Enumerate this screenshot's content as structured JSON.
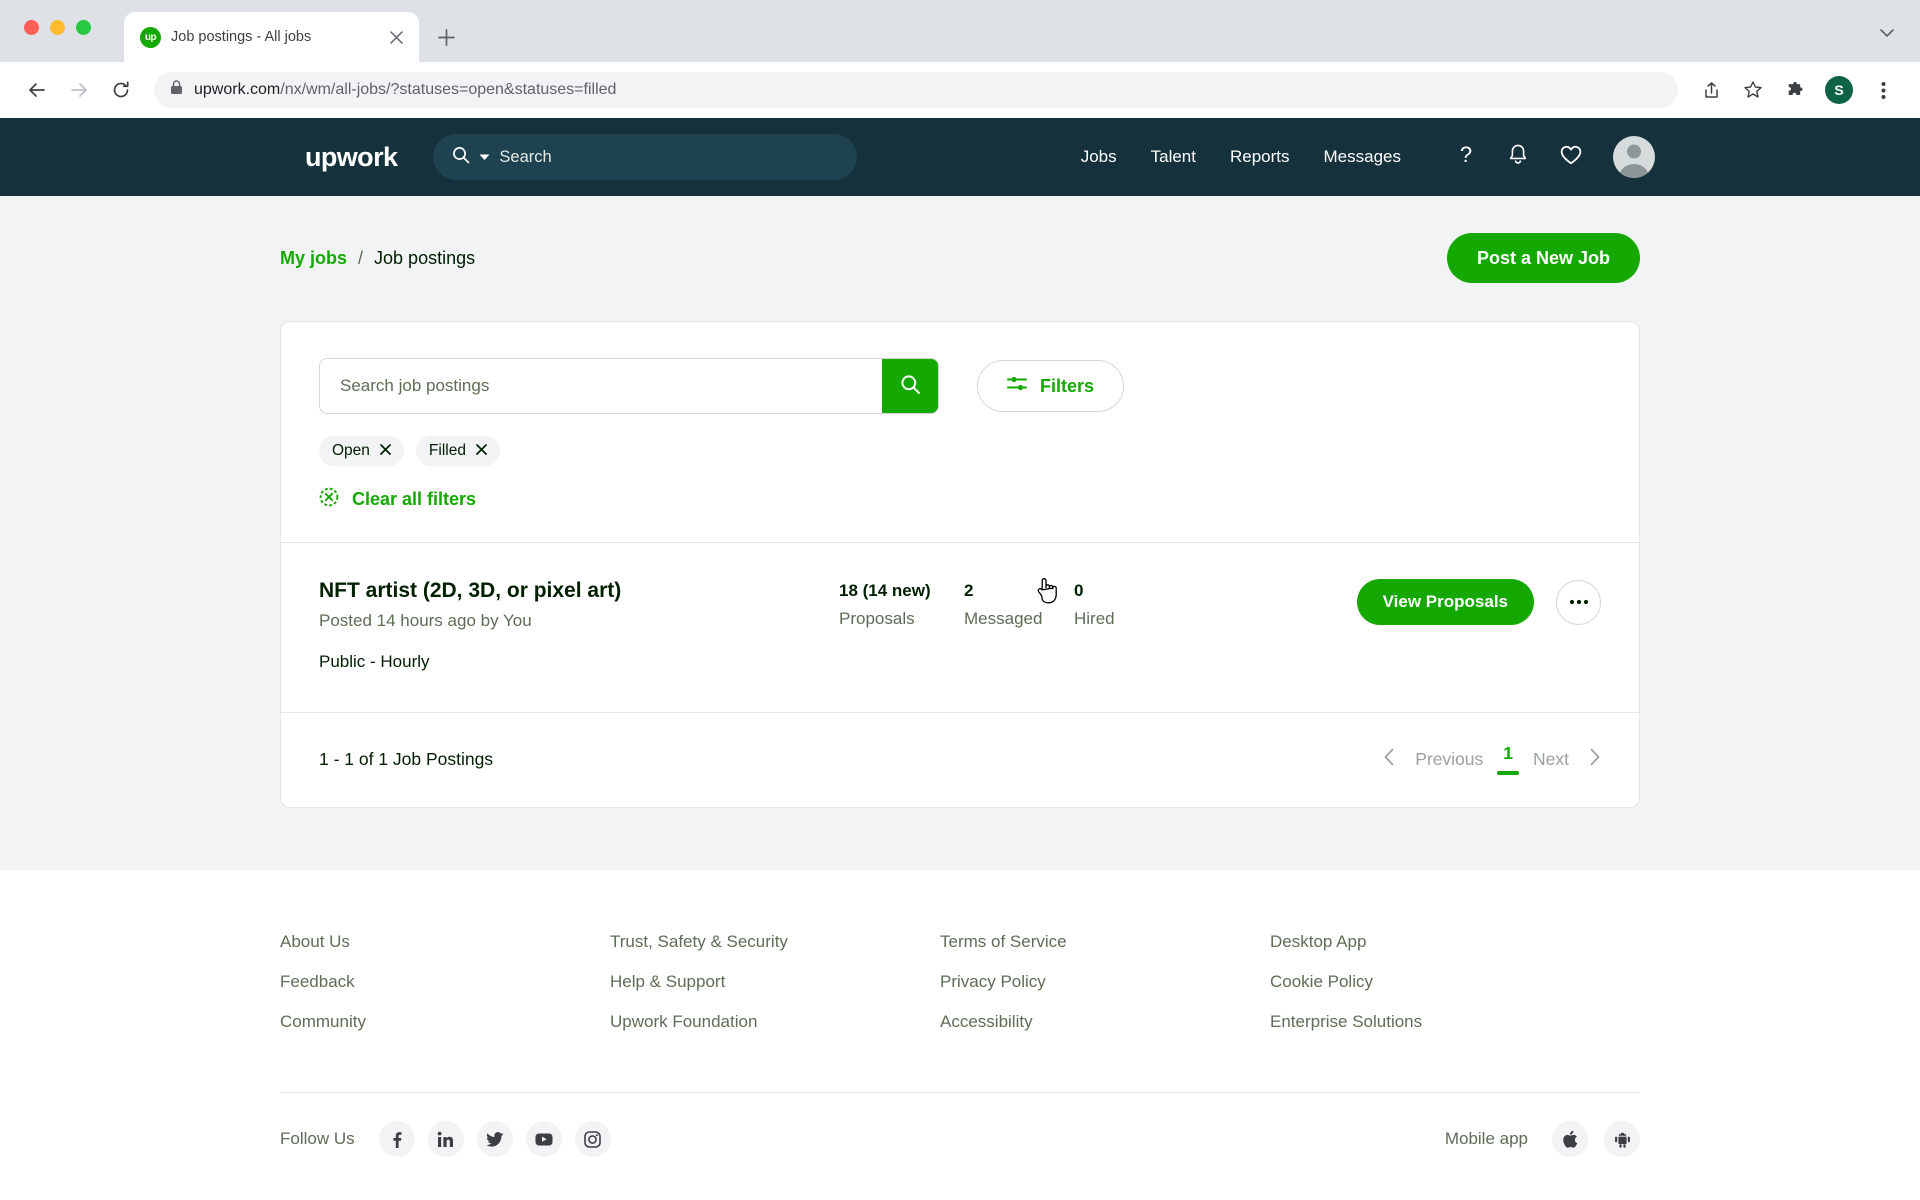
{
  "browser": {
    "tab": {
      "title": "Job postings - All jobs",
      "favicon_text": "up"
    },
    "new_tab_label": "+",
    "url_host": "upwork.com",
    "url_path": "/nx/wm/all-jobs/?statuses=open&statuses=filled",
    "profile_initial": "S"
  },
  "nav": {
    "logo": "upwork",
    "search_placeholder": "Search",
    "links": [
      "Jobs",
      "Talent",
      "Reports",
      "Messages"
    ],
    "icons": [
      "help-icon",
      "notifications-bell-icon",
      "saved-heart-icon",
      "user-avatar"
    ]
  },
  "breadcrumb": {
    "link": "My jobs",
    "separator": "/",
    "current": "Job postings"
  },
  "actions": {
    "post_job": "Post a New Job"
  },
  "search_panel": {
    "input_placeholder": "Search job postings",
    "input_value": "",
    "search_button_icon": "search-icon",
    "filters_label": "Filters",
    "chips": [
      {
        "label": "Open",
        "remove_icon": "close-icon"
      },
      {
        "label": "Filled",
        "remove_icon": "close-icon"
      }
    ],
    "clear_all_label": "Clear all filters",
    "clear_all_icon": "clear-circle-icon"
  },
  "jobs": [
    {
      "title": "NFT artist (2D, 3D, or pixel art)",
      "meta": "Posted 14 hours ago by You",
      "type": "Public - Hourly",
      "proposals_value": "18 (14 new)",
      "proposals_label": "Proposals",
      "messaged_value": "2",
      "messaged_label": "Messaged",
      "hired_value": "0",
      "hired_label": "Hired",
      "primary_action": "View Proposals",
      "more_action": "•••"
    }
  ],
  "pagination": {
    "count_text": "1 - 1 of 1 Job Postings",
    "previous": "Previous",
    "current_page": "1",
    "next": "Next"
  },
  "footer": {
    "columns": [
      {
        "links": [
          "About Us",
          "Feedback",
          "Community"
        ]
      },
      {
        "links": [
          "Trust, Safety & Security",
          "Help & Support",
          "Upwork Foundation"
        ]
      },
      {
        "links": [
          "Terms of Service",
          "Privacy Policy",
          "Accessibility"
        ]
      },
      {
        "links": [
          "Desktop App",
          "Cookie Policy",
          "Enterprise Solutions"
        ]
      }
    ],
    "follow_label": "Follow Us",
    "socials": [
      "facebook-icon",
      "linkedin-icon",
      "twitter-icon",
      "youtube-icon",
      "instagram-icon"
    ],
    "mobile_label": "Mobile app",
    "mobile_icons": [
      "apple-icon",
      "android-icon"
    ]
  },
  "colors": {
    "brand_green": "#14a800",
    "nav_dark": "#15313b",
    "text_primary": "#001e00",
    "text_muted": "#5e6d55"
  }
}
